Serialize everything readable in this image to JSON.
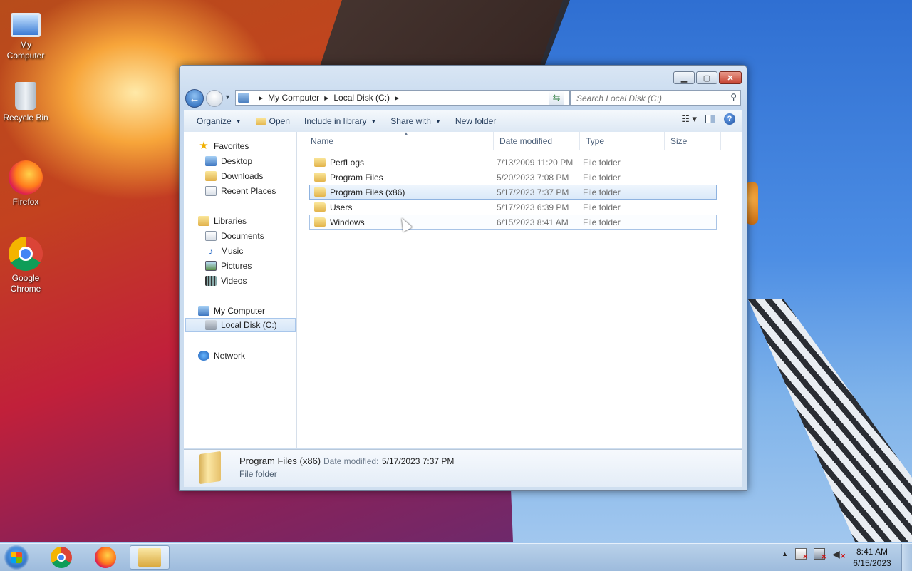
{
  "desktop": {
    "icons": [
      {
        "label": "My Computer"
      },
      {
        "label": "Recycle Bin"
      },
      {
        "label": "Firefox"
      },
      {
        "label": "Google Chrome"
      }
    ]
  },
  "window": {
    "breadcrumb": [
      "My Computer",
      "Local Disk (C:)"
    ],
    "search_placeholder": "Search Local Disk (C:)",
    "toolbar": {
      "organize": "Organize",
      "open": "Open",
      "include": "Include in library",
      "share": "Share with",
      "new_folder": "New folder"
    },
    "nav": {
      "favorites": "Favorites",
      "desktop": "Desktop",
      "downloads": "Downloads",
      "recent": "Recent Places",
      "libraries": "Libraries",
      "documents": "Documents",
      "music": "Music",
      "pictures": "Pictures",
      "videos": "Videos",
      "computer": "My Computer",
      "local_disk": "Local Disk (C:)",
      "network": "Network"
    },
    "columns": {
      "name": "Name",
      "date": "Date modified",
      "type": "Type",
      "size": "Size"
    },
    "files": [
      {
        "name": "PerfLogs",
        "date": "7/13/2009 11:20 PM",
        "type": "File folder"
      },
      {
        "name": "Program Files",
        "date": "5/20/2023 7:08 PM",
        "type": "File folder"
      },
      {
        "name": "Program Files (x86)",
        "date": "5/17/2023 7:37 PM",
        "type": "File folder"
      },
      {
        "name": "Users",
        "date": "5/17/2023 6:39 PM",
        "type": "File folder"
      },
      {
        "name": "Windows",
        "date": "6/15/2023 8:41 AM",
        "type": "File folder"
      }
    ],
    "details": {
      "name": "Program Files (x86)",
      "date_label": "Date modified:",
      "date_value": "5/17/2023 7:37 PM",
      "type": "File folder"
    }
  },
  "taskbar": {
    "time": "8:41 AM",
    "date": "6/15/2023"
  }
}
